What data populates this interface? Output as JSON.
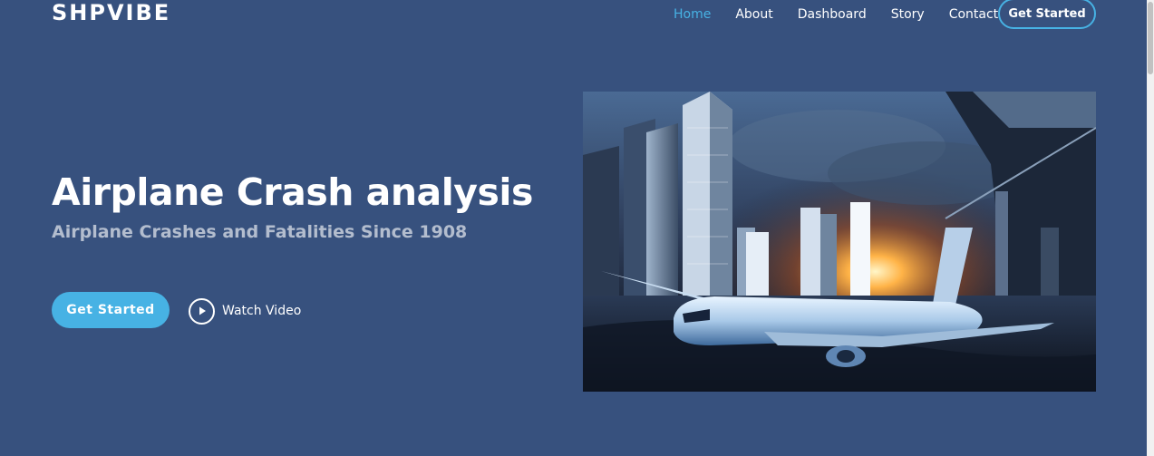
{
  "header": {
    "logo": "SHPVIBE",
    "nav": [
      {
        "label": "Home",
        "active": true
      },
      {
        "label": "About",
        "active": false
      },
      {
        "label": "Dashboard",
        "active": false
      },
      {
        "label": "Story",
        "active": false
      },
      {
        "label": "Contact",
        "active": false
      }
    ],
    "cta_label": "Get Started"
  },
  "hero": {
    "title": "Airplane Crash analysis",
    "subtitle": "Airplane Crashes and Fatalities Since 1908",
    "cta_label": "Get Started",
    "watch_label": "Watch Video"
  },
  "colors": {
    "background": "#37517e",
    "accent": "#47b2e4"
  },
  "icons": {
    "play": "play-circle-icon"
  }
}
